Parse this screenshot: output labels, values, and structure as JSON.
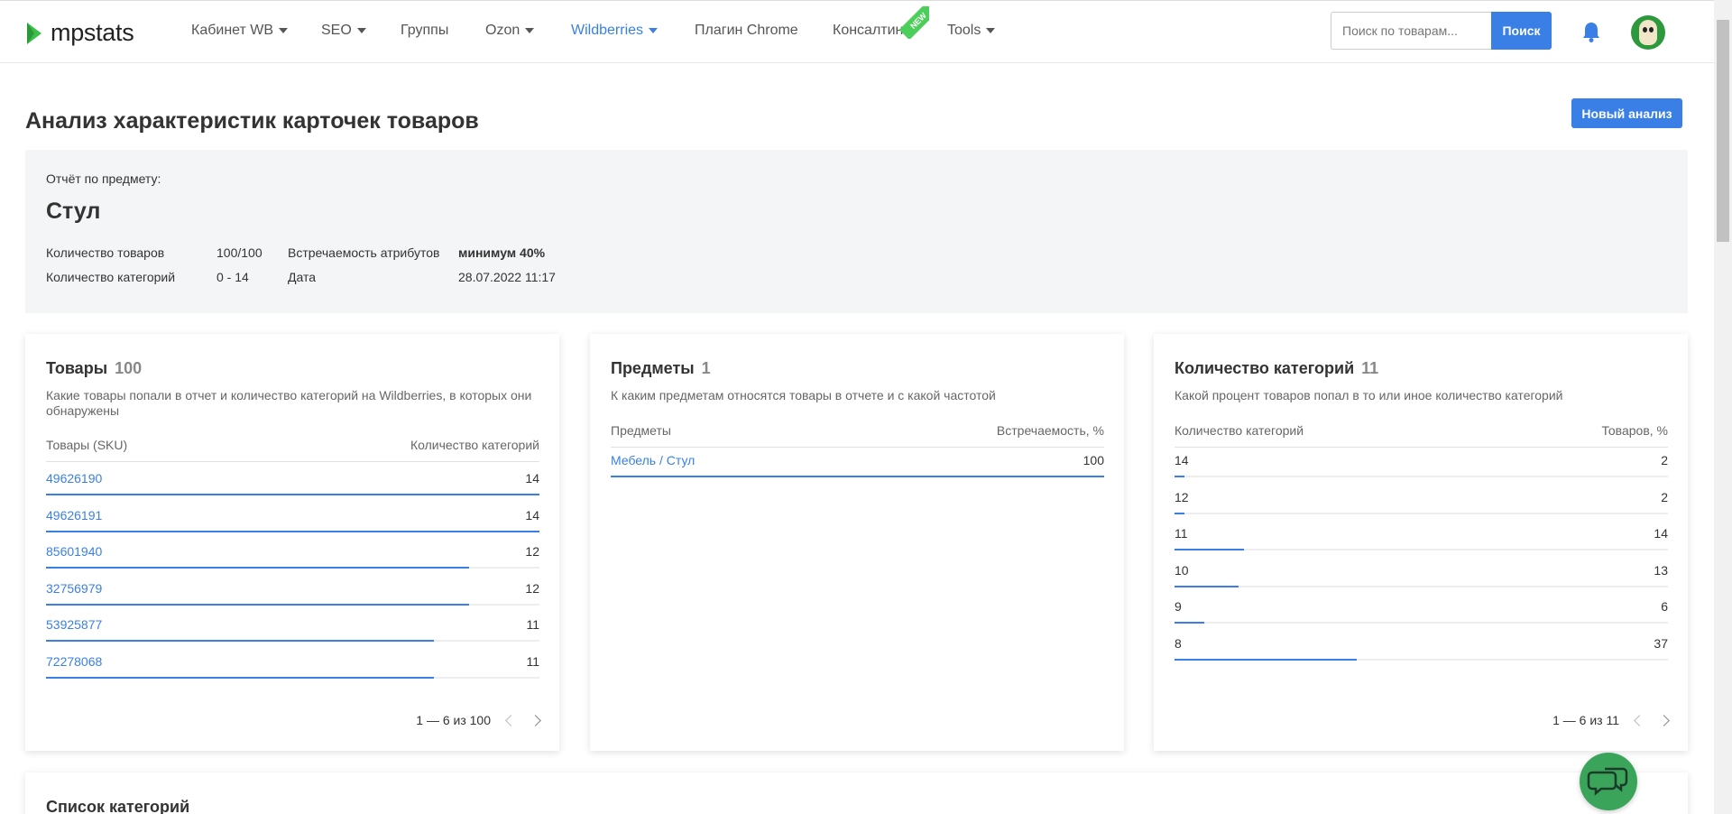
{
  "header": {
    "logo_text": "mpstats",
    "nav": [
      {
        "label": "Кабинет WB",
        "dropdown": true
      },
      {
        "label": "SEO",
        "dropdown": true
      },
      {
        "label": "Группы",
        "dropdown": false
      },
      {
        "label": "Ozon",
        "dropdown": true
      },
      {
        "label": "Wildberries",
        "dropdown": true,
        "active": true
      },
      {
        "label": "Плагин Chrome",
        "dropdown": false
      },
      {
        "label": "Консалтинг",
        "dropdown": false,
        "badge": "NEW"
      },
      {
        "label": "Tools",
        "dropdown": true
      }
    ],
    "search": {
      "placeholder": "Поиск по товарам...",
      "button": "Поиск"
    },
    "accent_color": "#3a7fe6"
  },
  "page": {
    "title": "Анализ характеристик карточек товаров",
    "new_analysis_button": "Новый анализ"
  },
  "report": {
    "label": "Отчёт по предмету:",
    "subject": "Стул",
    "fields": {
      "products_label": "Количество товаров",
      "products_value": "100/100",
      "categories_label": "Количество категорий",
      "categories_value": "0 - 14",
      "attr_label": "Встречаемость атрибутов",
      "attr_value": "минимум 40%",
      "date_label": "Дата",
      "date_value": "28.07.2022 11:17"
    }
  },
  "cards": {
    "products": {
      "title": "Товары",
      "count": "100",
      "description": "Какие товары попали в отчет и количество категорий на Wildberries, в которых они обнаружены",
      "col_left": "Товары (SKU)",
      "col_right": "Количество категорий",
      "max": 14,
      "rows": [
        {
          "key": "49626190",
          "value": 14
        },
        {
          "key": "49626191",
          "value": 14
        },
        {
          "key": "85601940",
          "value": 12
        },
        {
          "key": "32756979",
          "value": 12
        },
        {
          "key": "53925877",
          "value": 11
        },
        {
          "key": "72278068",
          "value": 11
        }
      ],
      "pager": "1 — 6 из 100"
    },
    "subjects": {
      "title": "Предметы",
      "count": "1",
      "description": "К каким предметам относятся товары в отчете и с какой частотой",
      "col_left": "Предметы",
      "col_right": "Встречаемость, %",
      "max": 100,
      "rows": [
        {
          "key": "Мебель / Стул",
          "value": 100
        }
      ]
    },
    "categories": {
      "title": "Количество категорий",
      "count": "11",
      "description": "Какой процент товаров попал в то или иное количество категорий",
      "col_left": "Количество категорий",
      "col_right": "Товаров, %",
      "max": 100,
      "rows": [
        {
          "key": "14",
          "value": 2
        },
        {
          "key": "12",
          "value": 2
        },
        {
          "key": "11",
          "value": 14
        },
        {
          "key": "10",
          "value": 13
        },
        {
          "key": "9",
          "value": 6
        },
        {
          "key": "8",
          "value": 37
        }
      ],
      "pager": "1 — 6 из 11"
    }
  },
  "next_section": {
    "title": "Список категорий"
  }
}
